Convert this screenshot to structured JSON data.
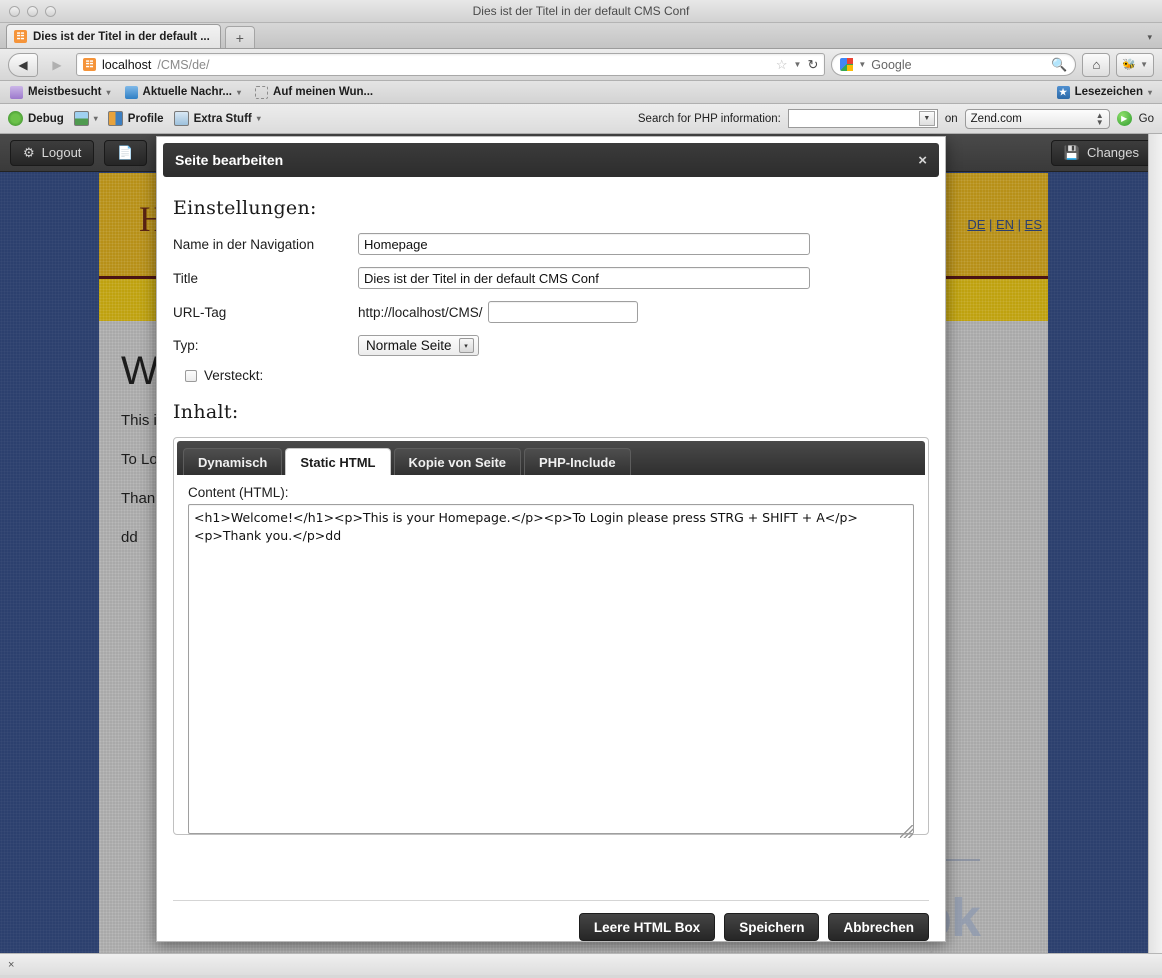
{
  "window": {
    "title": "Dies ist der Titel in der default CMS Conf"
  },
  "tab": {
    "label": "Dies ist der Titel in der default ...",
    "favicon": "cms-favicon",
    "newtab_label": "+"
  },
  "nav": {
    "back_label": "◀",
    "forward_label": "▶",
    "url_host": "localhost",
    "url_path": "/CMS/de/",
    "star_label": "☆",
    "reload_label": "↻",
    "search_placeholder": "Google",
    "search_value": "Google",
    "magnifier_label": "🔍",
    "home_label": "⌂"
  },
  "bookmarks": {
    "items": [
      {
        "label": "Meistbesucht",
        "icon": "folder-star-icon",
        "caret": "▾"
      },
      {
        "label": "Aktuelle Nachr...",
        "icon": "rss-icon",
        "caret": "▾"
      },
      {
        "label": "Auf meinen Wun...",
        "icon": "dashed-placeholder-icon",
        "caret": ""
      }
    ],
    "right_label": "Lesezeichen",
    "right_caret": "▾"
  },
  "zendbar": {
    "items": [
      {
        "label": "Debug",
        "icon": "bug-icon",
        "caret": ""
      },
      {
        "label": "",
        "icon": "image-icon",
        "caret": "▾"
      },
      {
        "label": "Profile",
        "icon": "profile-icon",
        "caret": ""
      },
      {
        "label": "Extra Stuff",
        "icon": "extra-stuff-icon",
        "caret": "▾"
      }
    ],
    "search_label": "Search for PHP information:",
    "search_value": "",
    "on_label": "on",
    "site_value": "Zend.com",
    "go_label": "Go"
  },
  "admin": {
    "logout_label": "Logout",
    "logout_icon": "trash-icon",
    "page_icon": "page-icon",
    "changes_label": "Changes",
    "changes_icon": "save-icon"
  },
  "site": {
    "logo": "Homepage",
    "lang_de": "DE",
    "lang_sep1": " | ",
    "lang_en": "EN",
    "lang_sep2": " | ",
    "lang_es": "ES",
    "h1": "Welcome!",
    "p1": "This is your Homepage.",
    "p2": "To Login please press STRG + SHIFT + A",
    "p3": "Thank you.",
    "p4": "dd",
    "watermark": "ook"
  },
  "modal": {
    "title": "Seite bearbeiten",
    "close_label": "×",
    "settings_heading": "Einstellungen:",
    "fields": {
      "nav_name_label": "Name in der Navigation",
      "nav_name_value": "Homepage",
      "title_label": "Title",
      "title_value": "Dies ist der Titel in der default CMS Conf",
      "urltag_label": "URL-Tag",
      "urltag_prefix": "http://localhost/CMS/",
      "urltag_value": "",
      "typ_label": "Typ:",
      "typ_value": "Normale Seite",
      "typ_caret": "▾",
      "hidden_label": "Versteckt:",
      "hidden_checked": false
    },
    "content_heading": "Inhalt:",
    "tabs": [
      {
        "label": "Dynamisch",
        "active": false
      },
      {
        "label": "Static HTML",
        "active": true
      },
      {
        "label": "Kopie von Seite",
        "active": false
      },
      {
        "label": "PHP-Include",
        "active": false
      }
    ],
    "content_label": "Content (HTML):",
    "content_value": "<h1>Welcome!</h1><p>This is your Homepage.</p><p>To Login please press STRG + SHIFT + A</p><p>Thank you.</p>dd",
    "buttons": [
      {
        "label": "Leere HTML Box",
        "name": "empty-html-box-button"
      },
      {
        "label": "Speichern",
        "name": "save-button"
      },
      {
        "label": "Abbrechen",
        "name": "cancel-button"
      }
    ]
  },
  "statusbar": {
    "close_label": "×"
  },
  "colors": {
    "modal_header": "#2d2d2d",
    "site_header": "#b79018",
    "site_sub": "#bfa20f",
    "page_bg": "#2c406e",
    "content_bg": "#a9a9a9"
  }
}
